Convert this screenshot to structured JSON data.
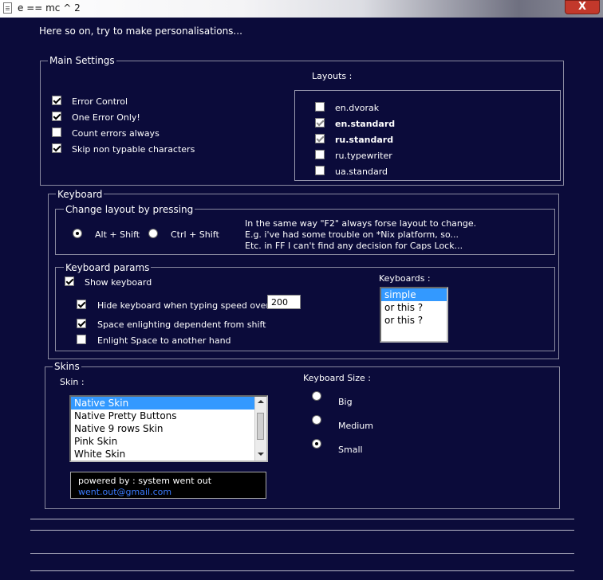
{
  "window": {
    "title": "e == mc ^ 2",
    "close_label": "X"
  },
  "intro": "Here so on, try to make personalisations...",
  "main_settings": {
    "legend": "Main Settings",
    "options": [
      {
        "label": "Error Control",
        "checked": true
      },
      {
        "label": "One Error Only!",
        "checked": true
      },
      {
        "label": "Count errors always",
        "checked": false
      },
      {
        "label": "Skip non typable characters",
        "checked": true
      }
    ],
    "layouts_label": "Layouts :",
    "layouts": [
      {
        "label": "en.dvorak",
        "checked": false,
        "bold": false
      },
      {
        "label": "en.standard",
        "checked": true,
        "bold": true
      },
      {
        "label": "ru.standard",
        "checked": true,
        "bold": true
      },
      {
        "label": "ru.typewriter",
        "checked": false,
        "bold": false
      },
      {
        "label": "ua.standard",
        "checked": false,
        "bold": false
      }
    ]
  },
  "keyboard": {
    "legend": "Keyboard",
    "change_layout": {
      "legend": "Change layout by pressing",
      "options": [
        {
          "label": "Alt + Shift",
          "selected": true
        },
        {
          "label": "Ctrl + Shift",
          "selected": false
        }
      ],
      "note": [
        "In the same way \"F2\" always forse layout to change.",
        "E.g. i've had some trouble on *Nix platform, so...",
        "Etc. in FF I can't find any decision for Caps Lock..."
      ]
    },
    "params": {
      "legend": "Keyboard params",
      "show_keyboard": "Show keyboard",
      "hide_keyboard": "Hide keyboard when typing speed over :",
      "speed_value": "200",
      "space_enlight": "Space enlighting dependent from shift",
      "enlight_space": "Enlight Space to another hand",
      "keyboards_label": "Keyboards :",
      "keyboards": [
        "simple",
        "or this ?",
        "or this ?"
      ]
    }
  },
  "skins": {
    "legend": "Skins",
    "skin_label": "Skin :",
    "skins": [
      "Native Skin",
      "Native Pretty Buttons",
      "Native 9 rows Skin",
      "Pink Skin",
      "White Skin"
    ],
    "size_label": "Keyboard Size :",
    "sizes": [
      {
        "label": "Big",
        "selected": false
      },
      {
        "label": "Medium",
        "selected": false
      },
      {
        "label": "Small",
        "selected": true
      }
    ],
    "powered_by": "powered by : system went out",
    "email": "went.out@gmail.com"
  },
  "colors": {
    "background": "#0b0b3a",
    "selection": "#3399ff",
    "close": "#c2382b"
  }
}
